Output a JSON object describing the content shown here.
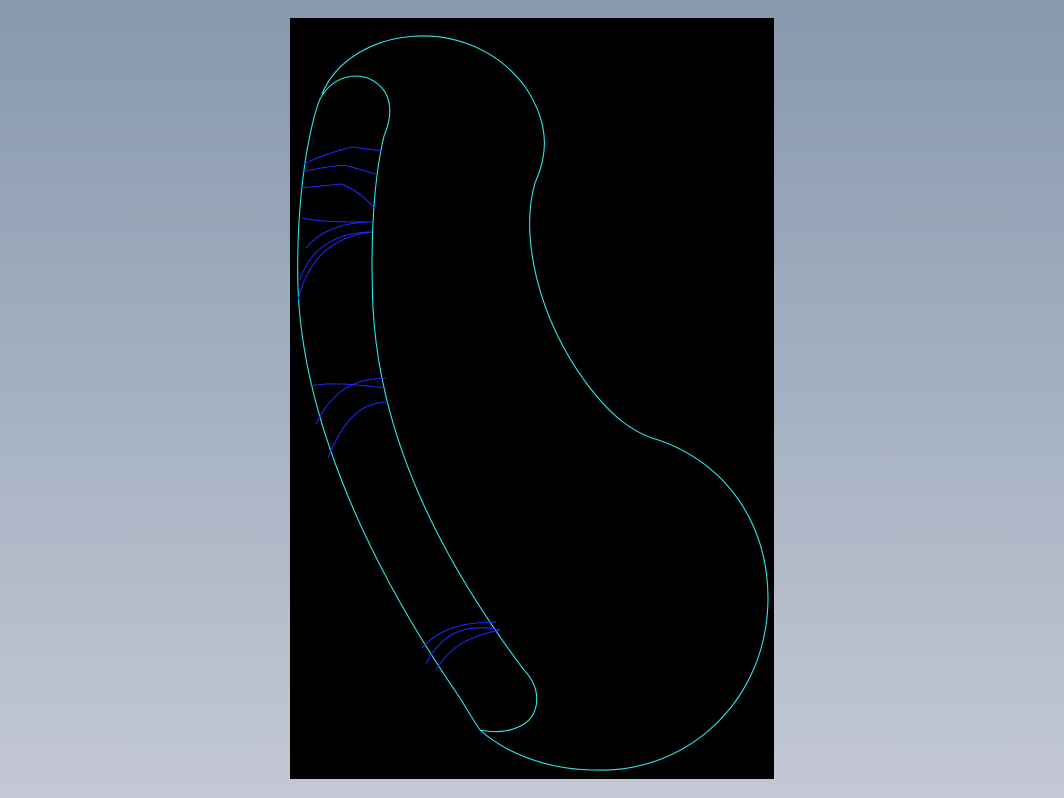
{
  "viewport": {
    "background": "#000000",
    "page_background": [
      "#8798ad",
      "#c4c8d4"
    ]
  },
  "drawing": {
    "type": "cad-sketch",
    "view": "top",
    "colors": {
      "outline": "#2fe6e6",
      "hatch": "#1f2bff"
    },
    "elements": [
      "outer-cam-profile",
      "inner-slot-profile",
      "slot-upper-end-arc",
      "slot-lower-end-arc",
      "hatch-group-upper",
      "hatch-group-middle",
      "hatch-group-lower"
    ]
  }
}
